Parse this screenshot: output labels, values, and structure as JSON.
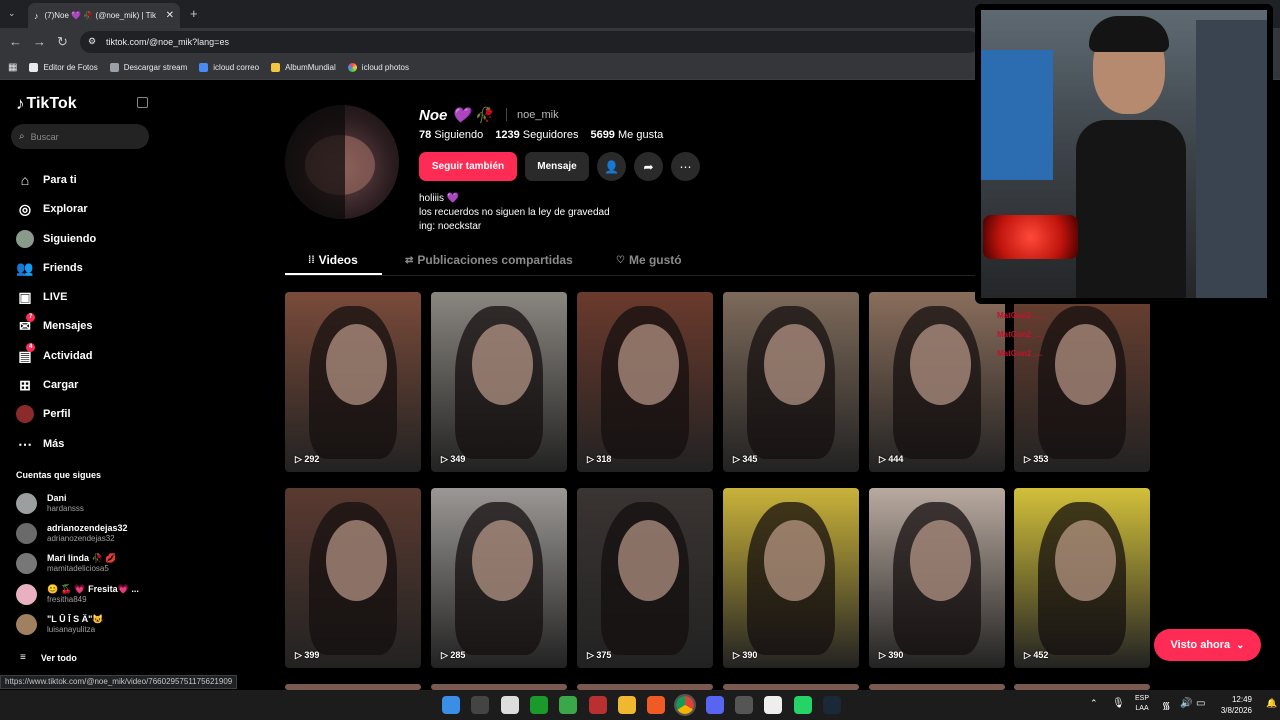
{
  "browser": {
    "tab_title": "(7)Noe 💜 🥀 (@noe_mik) | Tik",
    "url": "tiktok.com/@noe_mik?lang=es",
    "bookmarks": [
      "Editor de Fotos",
      "Descargar stream",
      "icloud correo",
      "AlbumMundial",
      "icloud photos"
    ],
    "status_url": "https://www.tiktok.com/@noe_mik/video/7660295751175621909"
  },
  "sidebar": {
    "logo": "TikTok",
    "search_placeholder": "Buscar",
    "items": [
      {
        "label": "Para ti",
        "icon": "home-icon"
      },
      {
        "label": "Explorar",
        "icon": "compass-icon"
      },
      {
        "label": "Siguiendo",
        "icon": "following-avatar-icon"
      },
      {
        "label": "Friends",
        "icon": "friends-icon"
      },
      {
        "label": "LIVE",
        "icon": "live-icon"
      },
      {
        "label": "Mensajes",
        "icon": "messages-icon",
        "badge": "7"
      },
      {
        "label": "Actividad",
        "icon": "activity-icon",
        "badge": "4"
      },
      {
        "label": "Cargar",
        "icon": "upload-icon"
      },
      {
        "label": "Perfil",
        "icon": "profile-avatar-icon"
      },
      {
        "label": "Más",
        "icon": "more-icon"
      }
    ],
    "following_title": "Cuentas que sigues",
    "following": [
      {
        "name": "Dani",
        "handle": "hardansss"
      },
      {
        "name": "adrianozendejas32",
        "handle": "adrianozendejas32"
      },
      {
        "name": "Mari linda 🥀 💋",
        "handle": "mamitadeliciosa5"
      },
      {
        "name": "😊 🍒 💗 Fresita💗 ...",
        "handle": "fresitha849"
      },
      {
        "name": "\"L Ū Ī S Ä\"😺",
        "handle": "luisanayulitza"
      }
    ],
    "see_all": "Ver todo"
  },
  "profile": {
    "name": "Noe 💜 🥀",
    "handle": "noe_mik",
    "following_count": "78",
    "following_label": "Siguiendo",
    "followers_count": "1239",
    "followers_label": "Seguidores",
    "likes_count": "5699",
    "likes_label": "Me gusta",
    "follow_back": "Seguir también",
    "message": "Mensaje",
    "bio": [
      "holiiis 💜",
      "los recuerdos no siguen la ley de gravedad",
      "ing: noeckstar"
    ]
  },
  "tabs": [
    "Videos",
    "Publicaciones compartidas",
    "Me gustó"
  ],
  "videos": [
    {
      "plays": "292",
      "bg": "#7a4b3a"
    },
    {
      "plays": "349",
      "bg": "#8a8680"
    },
    {
      "plays": "318",
      "bg": "#6b3a2c"
    },
    {
      "plays": "345",
      "bg": "#7d6a5a"
    },
    {
      "plays": "444",
      "bg": "#8a6e5c"
    },
    {
      "plays": "353",
      "bg": "#6a4030"
    },
    {
      "plays": "399",
      "bg": "#5a3a30"
    },
    {
      "plays": "285",
      "bg": "#9a9794"
    },
    {
      "plays": "375",
      "bg": "#3a3432"
    },
    {
      "plays": "390",
      "bg": "#c9b23a"
    },
    {
      "plays": "390",
      "bg": "#b9aaa0"
    },
    {
      "plays": "452",
      "bg": "#d2c03a"
    }
  ],
  "overlay_chat": [
    "MatGon2_...",
    "MatGon2_...",
    "MatGon2_..."
  ],
  "visto_ahora": "Visto ahora",
  "taskbar": {
    "lang1": "ESP",
    "lang2": "LAA",
    "time": "12:49",
    "date": "3/8/2026"
  }
}
